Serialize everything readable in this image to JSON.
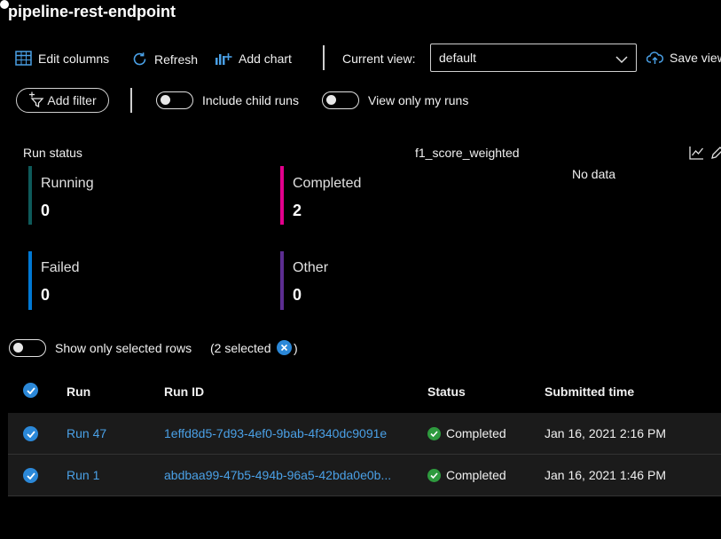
{
  "page": {
    "title": "pipeline-rest-endpoint"
  },
  "toolbar": {
    "edit_columns": "Edit columns",
    "refresh": "Refresh",
    "add_chart": "Add chart",
    "current_view_label": "Current view:",
    "current_view_value": "default",
    "save_view": "Save view"
  },
  "filters": {
    "add_filter": "Add filter",
    "include_child_runs": "Include child runs",
    "view_only_my_runs": "View only my runs"
  },
  "run_status": {
    "title": "Run status",
    "tiles": [
      {
        "label": "Running",
        "value": "0",
        "color": "#0e5a5a"
      },
      {
        "label": "Completed",
        "value": "2",
        "color": "#e3008c"
      },
      {
        "label": "Failed",
        "value": "0",
        "color": "#0078d4"
      },
      {
        "label": "Other",
        "value": "0",
        "color": "#5c2d91"
      }
    ]
  },
  "metric_chart": {
    "title": "f1_score_weighted",
    "empty_text": "No data"
  },
  "selection": {
    "show_only_selected": "Show only selected rows",
    "selected_count": "(2 selected",
    "selected_close": ")"
  },
  "table": {
    "headers": {
      "run": "Run",
      "run_id": "Run ID",
      "status": "Status",
      "submitted": "Submitted time"
    },
    "rows": [
      {
        "run": "Run 47",
        "run_id": "1effd8d5-7d93-4ef0-9bab-4f340dc9091e",
        "status": "Completed",
        "submitted": "Jan 16, 2021 2:16 PM"
      },
      {
        "run": "Run 1",
        "run_id": "abdbaa99-47b5-494b-96a5-42bda0e0b...",
        "status": "Completed",
        "submitted": "Jan 16, 2021 1:46 PM"
      }
    ]
  },
  "colors": {
    "accent": "#2b88d8",
    "link": "#4aa0e6",
    "success": "#2e9a3e"
  }
}
